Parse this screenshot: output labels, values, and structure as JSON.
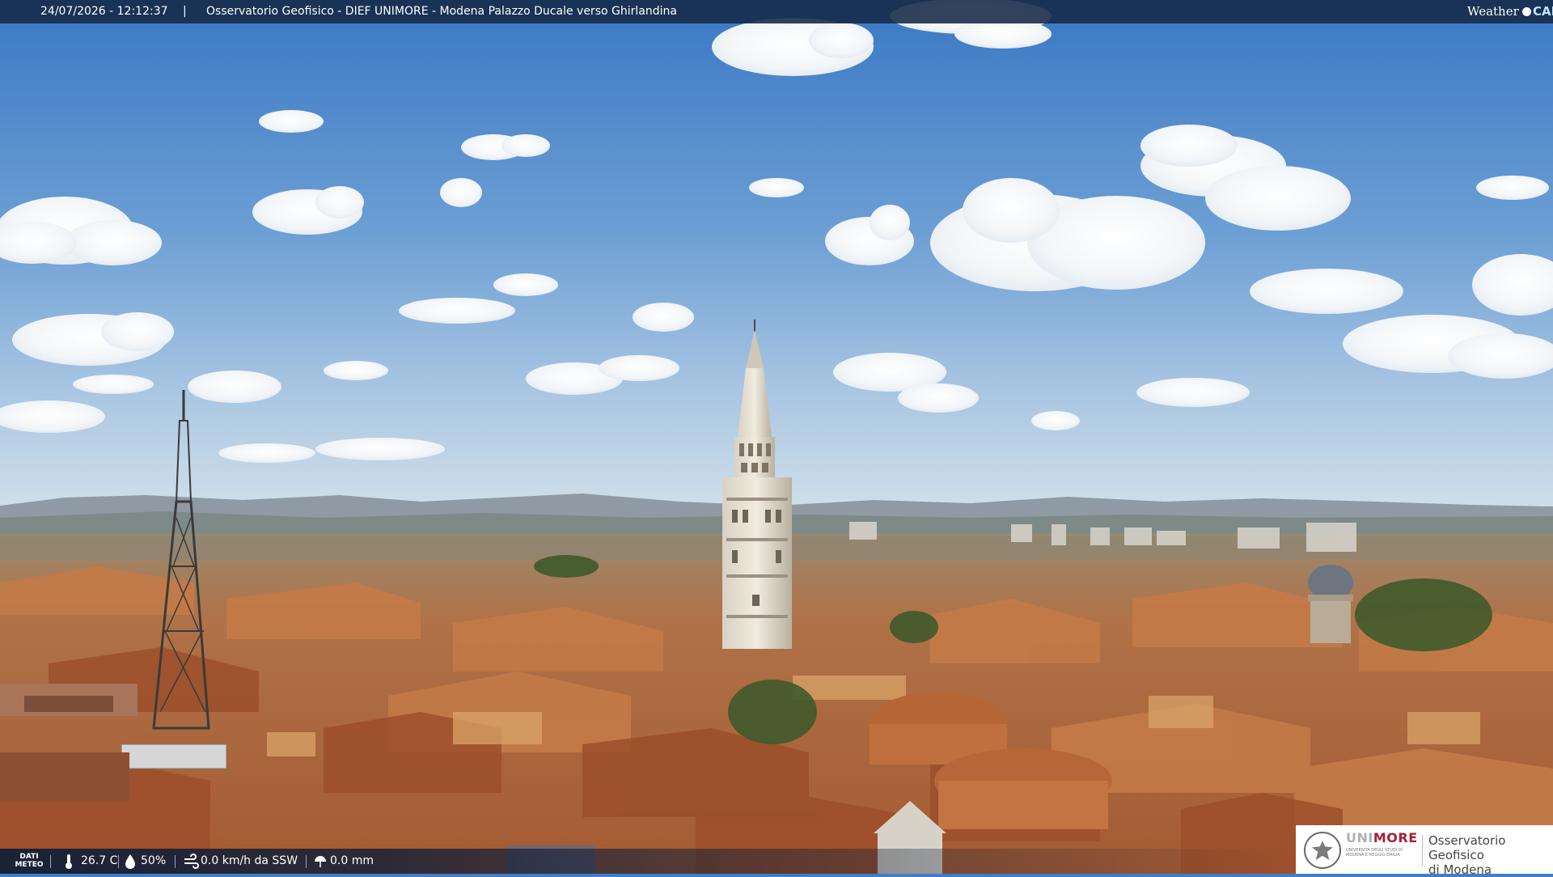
{
  "header": {
    "datetime": "24/07/2026 - 12:12:37",
    "separator": "|",
    "title": "Osservatorio Geofisico - DIEF UNIMORE - Modena Palazzo Ducale verso Ghirlandina"
  },
  "brand": {
    "weather_word": "Weather",
    "cam_word": "CAM"
  },
  "weather": {
    "label_line1": "DATI",
    "label_line2": "METEO",
    "temperature": "26.7 C",
    "humidity": "50%",
    "wind": "0.0 km/h da SSW",
    "rain": "0.0 mm"
  },
  "institution": {
    "name_part1": "UNI",
    "name_part2": "MORE",
    "subtitle": "UNIVERSITÀ DEGLI STUDI DI MODENA E REGGIO EMILIA",
    "observatory_line1": "Osservatorio Geofisico",
    "observatory_line2": "di Modena"
  },
  "colors": {
    "sky_top": "#3d7cc6",
    "sky_horizon": "#c9dce8",
    "roofs": "#b8683c",
    "banner": "#142846",
    "accent_logo": "#a32035"
  },
  "icons": [
    "thermometer-icon",
    "humidity-icon",
    "wind-icon",
    "rain-icon",
    "university-seal-icon"
  ]
}
